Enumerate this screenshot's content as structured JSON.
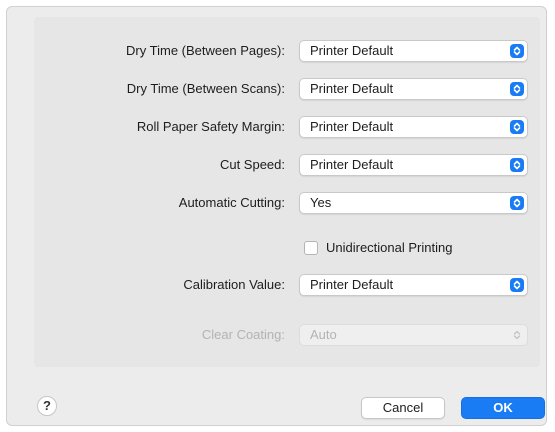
{
  "settings": [
    {
      "label": "Dry Time (Between Pages):",
      "value": "Printer Default",
      "enabled": true
    },
    {
      "label": "Dry Time (Between Scans):",
      "value": "Printer Default",
      "enabled": true
    },
    {
      "label": "Roll Paper Safety Margin:",
      "value": "Printer Default",
      "enabled": true
    },
    {
      "label": "Cut Speed:",
      "value": "Printer Default",
      "enabled": true
    },
    {
      "label": "Automatic Cutting:",
      "value": "Yes",
      "enabled": true
    }
  ],
  "unidirectional": {
    "label": "Unidirectional Printing",
    "checked": false
  },
  "calibration": {
    "label": "Calibration Value:",
    "value": "Printer Default",
    "enabled": true
  },
  "clear_coating": {
    "label": "Clear Coating:",
    "value": "Auto",
    "enabled": false
  },
  "footer": {
    "help": "?",
    "cancel": "Cancel",
    "ok": "OK"
  },
  "colors": {
    "accent": "#1a7cf5",
    "disabled_text": "#b3b3b3"
  }
}
